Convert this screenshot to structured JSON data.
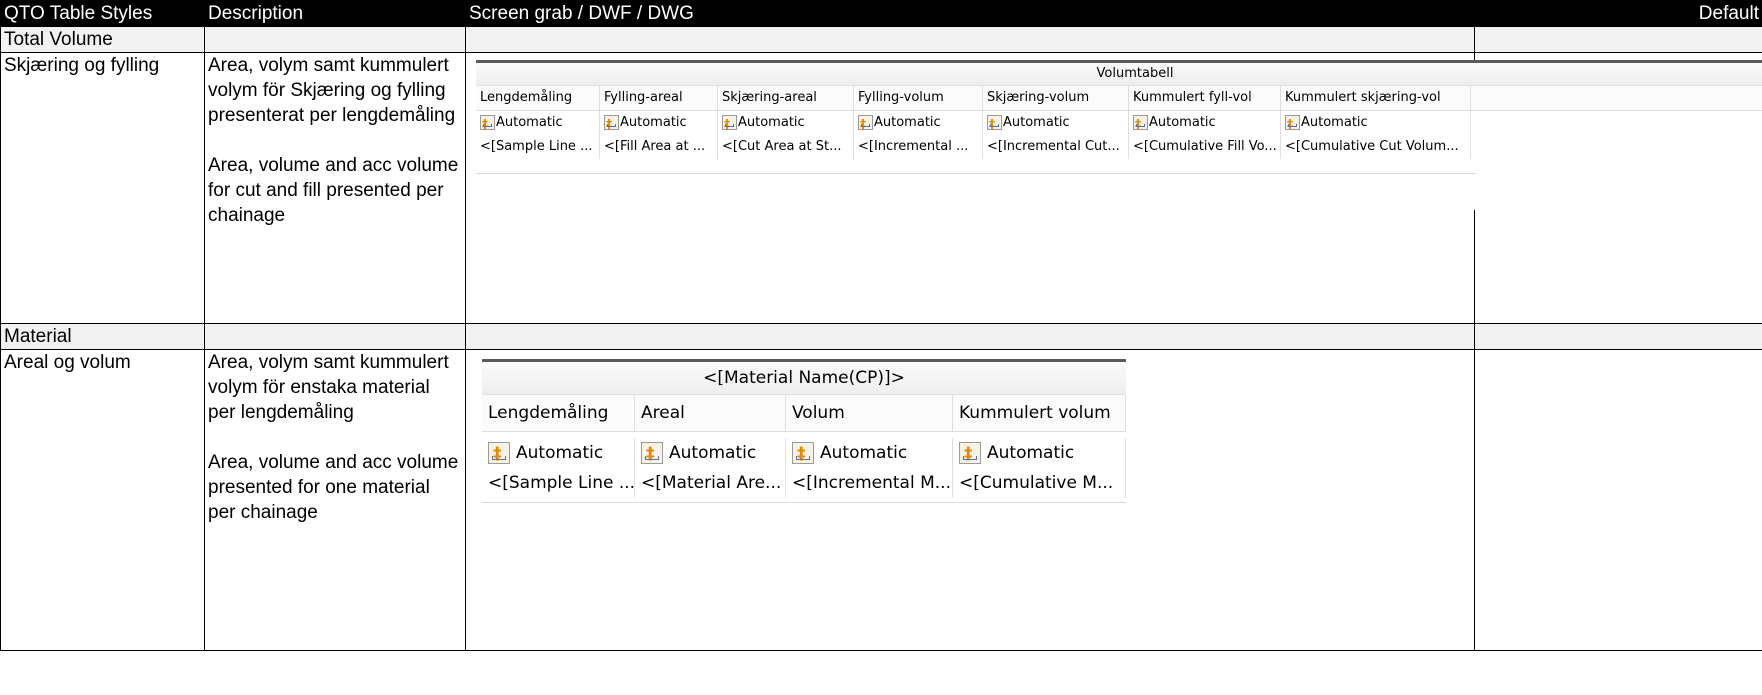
{
  "header": {
    "col1": "QTO Table Styles",
    "col2": "Description",
    "col3": "Screen grab / DWF / DWG",
    "col4": "Default"
  },
  "sections": [
    {
      "label": "Total Volume",
      "row": {
        "style": "Skjæring og fylling",
        "desc_no": "Area, volym samt kummulert volym för Skjæring og fylling presenterat per lengdemåling",
        "desc_en": "Area, volume and acc volume for cut and fill presented per chainage",
        "grab": {
          "title": "Volumtabell",
          "columns": [
            "Lengdemåling",
            "Fylling-areal",
            "Skjæring-areal",
            "Fylling-volum",
            "Skjæring-volum",
            "Kummulert fyll-vol",
            "Kummulert skjæring-vol"
          ],
          "auto_label": "Automatic",
          "values": [
            "<[Sample Line ...",
            "<[Fill Area at ...",
            "<[Cut Area at St...",
            "<[Incremental ...",
            "<[Incremental Cut...",
            "<[Cumulative Fill Vo...",
            "<[Cumulative Cut Volum..."
          ]
        }
      }
    },
    {
      "label": "Material",
      "row": {
        "style": "Areal og volum",
        "desc_no": "Area, volym samt kummulert volym för enstaka material per lengdemåling",
        "desc_en": "Area, volume and acc volume presented for one material per chainage",
        "grab": {
          "title": "<[Material Name(CP)]>",
          "columns": [
            "Lengdemåling",
            "Areal",
            "Volum",
            "Kummulert volum"
          ],
          "auto_label": "Automatic",
          "values": [
            "<[Sample Line ...",
            "<[Material Are...",
            "<[Incremental M...",
            "<[Cumulative M..."
          ]
        }
      }
    }
  ]
}
